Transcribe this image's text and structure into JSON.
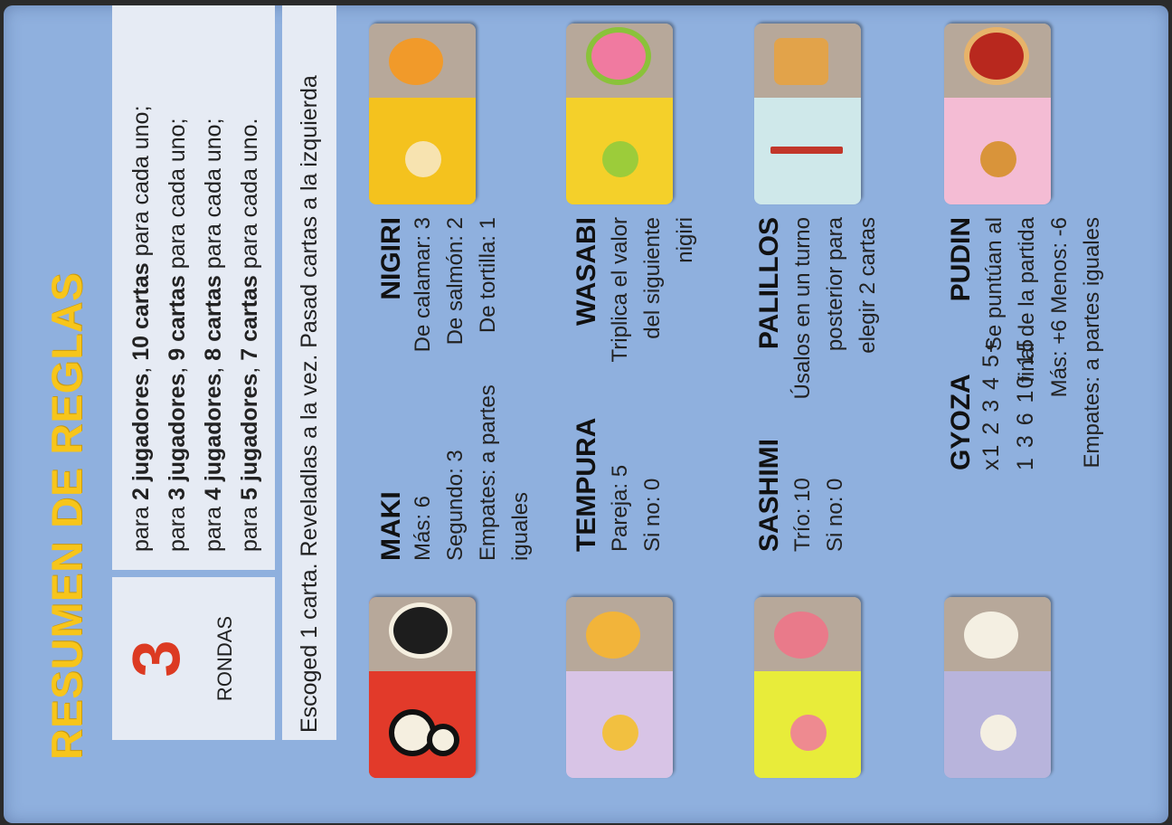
{
  "title": "RESUMEN DE REGLAS",
  "rounds": {
    "number": "3",
    "label": "RONDAS"
  },
  "players": [
    {
      "pre": "para ",
      "num": "2",
      "jug": " jugadores",
      "mid": ", ",
      "cards": "10 cartas",
      "post": " para cada uno;"
    },
    {
      "pre": "para ",
      "num": "3",
      "jug": " jugadores",
      "mid": ", ",
      "cards": "9 cartas",
      "post": " para cada uno;"
    },
    {
      "pre": "para ",
      "num": "4",
      "jug": " jugadores",
      "mid": ", ",
      "cards": "8 cartas",
      "post": " para cada uno;"
    },
    {
      "pre": "para ",
      "num": "5",
      "jug": " jugadores",
      "mid": ", ",
      "cards": "7 cartas",
      "post": " para cada uno."
    }
  ],
  "turn_rule": "Escoged 1 carta. Reveladlas a la vez. Pasad cartas a la izquierda",
  "left": {
    "maki": {
      "name": "MAKI",
      "lines": [
        "Más: 6",
        "Segundo: 3",
        "Empates: a partes",
        "iguales"
      ]
    },
    "tempura": {
      "name": "TEMPURA",
      "lines": [
        "Pareja: 5",
        "Si no: 0"
      ]
    },
    "sashimi": {
      "name": "SASHIMI",
      "lines": [
        "Trío: 10",
        "Si no: 0"
      ]
    },
    "gyoza": {
      "name": "GYOZA",
      "row1": "x1  2  3   4   5+",
      "row2": "1   3   6  10  15"
    }
  },
  "right": {
    "nigiri": {
      "name": "NIGIRI",
      "lines": [
        "De calamar: 3",
        "De salmón: 2",
        "De tortilla: 1"
      ]
    },
    "wasabi": {
      "name": "WASABI",
      "lines": [
        "Triplica el valor",
        "del siguiente",
        "nigiri"
      ]
    },
    "palillos": {
      "name": "PALILLOS",
      "lines": [
        "Úsalos en un turno",
        "posterior para",
        "elegir 2 cartas"
      ]
    },
    "pudin": {
      "name": "PUDIN",
      "lines": [
        "Se puntúan al",
        "final de la partida",
        "Más: +6 Menos: -6",
        "Empates: a partes iguales"
      ]
    }
  },
  "colors": {
    "background": "#8fb0de",
    "title": "#f7c51b",
    "rounds_number": "#dc3a22",
    "box": "#e6ebf4"
  }
}
